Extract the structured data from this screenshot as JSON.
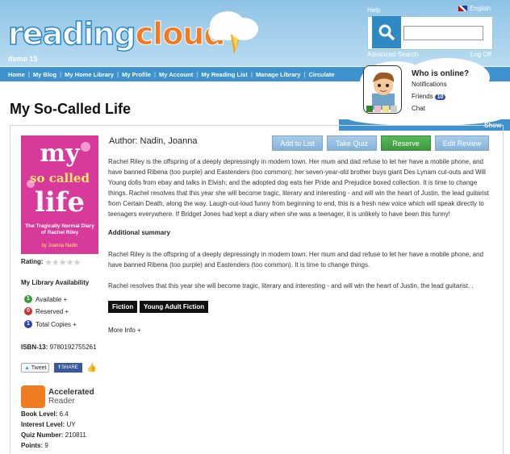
{
  "header": {
    "logo_part1": "reading",
    "logo_part2": "cloud",
    "site_sub": "demo 15",
    "help": "Help",
    "language": "English",
    "advanced_search": "Advanced Search",
    "log_off": "Log Off",
    "search_icon": "search-icon"
  },
  "nav": {
    "items": [
      "Home",
      "My Blog",
      "My Home Library",
      "My Profile",
      "My Account",
      "My Reading List",
      "Manage Library",
      "Circulate"
    ]
  },
  "online": {
    "title": "Who is online?",
    "notifications": "Notifications",
    "friends": "Friends",
    "friends_count": "10",
    "chat": "Chat",
    "show": "Show"
  },
  "book": {
    "title": "My So-Called Life",
    "author_label": "Author:",
    "author": "Nadin, Joanna",
    "cover_title": "my so called life",
    "cover_subtitle": "The Tragically Normal Diary of Rachel Riley",
    "cover_author": "by Joanna Nadin",
    "description": "Rachel Riley is the offspring of a deeply depressingly in modern town. Her mum and dad refuse to let her have a mobile phone, and have banned Ribena (too purple) and Eastenders (too common); her seven-year-old brother buys giant Des Lynam cut-outs and Will Young dolls from ebay and talks in Elvish; and the adopted dog eats her Pride and Prejudice boxed collection. It is time to change things. Rachel resolves that this year she will become tragic, literary and interesting - and will win the heart of Justin, the lead guitarist from Certain Death, along the way. Laugh-out-loud funny from beginning to end, this is a fresh new voice which will speak directly to teenagers everywhere. If Bridget Jones had kept a diary when she was a teenager, it is unlikely to have been this funny!",
    "additional_heading": "Additional summary",
    "additional_1": "Rachel Riley is the offspring of a deeply depressingly in modern town. Her mum and dad refuse to let her have a mobile phone, and have banned Ribena (too purple) and Eastenders (too common). It is time to change things.",
    "additional_2": "Rachel resolves that this year she will become tragic, literary and interesting - and will win the heart of Justin, the lead guitarist. .",
    "tags": [
      "Fiction",
      "Young Adult Fiction"
    ],
    "more_info": "More Info +"
  },
  "actions": {
    "add_to_list": "Add to List",
    "take_quiz": "Take Quiz",
    "reserve": "Reserve",
    "edit_review": "Edit Review"
  },
  "sidebar": {
    "rating_label": "Rating:",
    "rating_value": 0,
    "rating_max": 5,
    "availability_title": "My Library Availability",
    "available_count": "1",
    "available_label": "Available +",
    "reserved_count": "0",
    "reserved_label": "Reserved +",
    "total_count": "1",
    "total_label": "Total Copies +",
    "isbn_label": "ISBN-13:",
    "isbn": "9780192755261",
    "tweet": "Tweet",
    "share": "SHARE",
    "ar_name_1": "Accelerated",
    "ar_name_2": "Reader",
    "book_level_label": "Book Level:",
    "book_level": "6.4",
    "interest_level_label": "Interest Level:",
    "interest_level": "UY",
    "quiz_number_label": "Quiz Number:",
    "quiz_number": "210811",
    "points_label": "Points:",
    "points": "9"
  },
  "colors": {
    "header_sky": "#8ec3e6",
    "nav": "#3e93cf",
    "reserve_green": "#4aaa4c",
    "action_blue": "#86b3da",
    "cover_pink": "#d83a9c"
  }
}
